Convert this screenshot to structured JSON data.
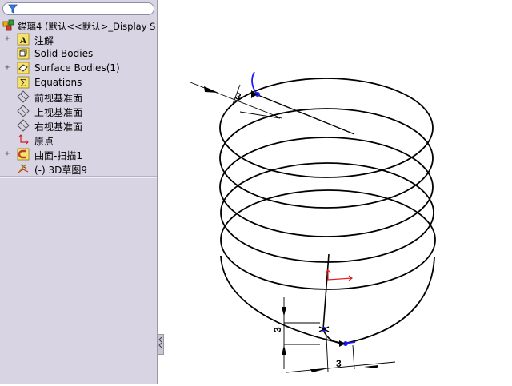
{
  "feature_tree": {
    "root_label": "錨璃4  (默认<<默认>_Display S",
    "items": [
      {
        "label": "注解",
        "icon": "annotations-icon",
        "expandable": true
      },
      {
        "label": "Solid Bodies",
        "icon": "solid-bodies-icon",
        "expandable": false
      },
      {
        "label": "Surface Bodies(1)",
        "icon": "surface-bodies-icon",
        "expandable": true
      },
      {
        "label": "Equations",
        "icon": "equations-icon",
        "expandable": false
      },
      {
        "label": "前视基准面",
        "icon": "plane-icon",
        "expandable": false
      },
      {
        "label": "上视基准面",
        "icon": "plane-icon",
        "expandable": false
      },
      {
        "label": "右视基准面",
        "icon": "plane-icon",
        "expandable": false
      },
      {
        "label": "原点",
        "icon": "origin-icon",
        "expandable": false
      },
      {
        "label": "曲面-扫描1",
        "icon": "sweep-surface-icon",
        "expandable": true
      },
      {
        "label": "(-) 3D草图9",
        "icon": "3d-sketch-icon",
        "expandable": false
      }
    ]
  },
  "viewport": {
    "dimensions": {
      "top": "3",
      "side": "3",
      "bottom": "3"
    },
    "colors": {
      "helix": "#000000",
      "endpoint": "#1a1aff",
      "origin": "#e02020"
    }
  }
}
